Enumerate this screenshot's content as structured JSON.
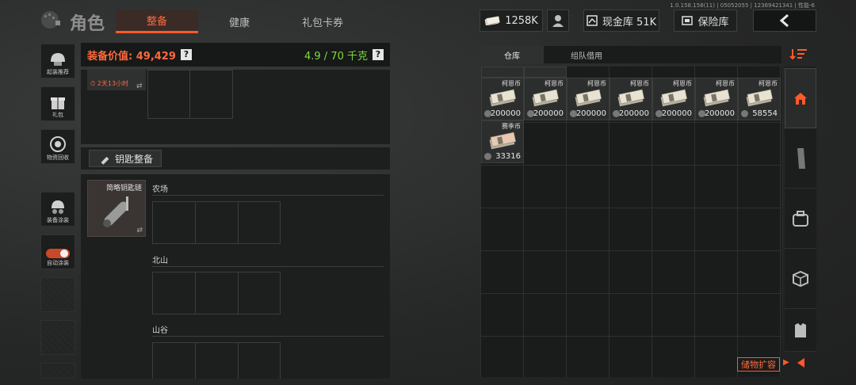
{
  "version_text": "1.0.158.158(11) | 05052055 | 12369421341 | 性能-6",
  "header": {
    "title": "角色",
    "tabs": [
      {
        "label": "整备",
        "active": true
      },
      {
        "label": "健康",
        "active": false
      },
      {
        "label": "礼包卡券",
        "active": false
      }
    ],
    "currency_amount": "1258K",
    "cash_vault_label": "现金库 51K",
    "safe_label": "保险库"
  },
  "sidebar": {
    "items": [
      {
        "label": "起装推荐",
        "icon": "helmet-icon"
      },
      {
        "label": "礼包",
        "icon": "gift-icon"
      },
      {
        "label": "物资回收",
        "icon": "recycle-icon"
      },
      {
        "label": "装备涂装",
        "icon": "paint-icon"
      },
      {
        "label": "自动涂装",
        "icon": "toggle-icon"
      }
    ]
  },
  "loadout": {
    "value_label": "装备价值: 49,429",
    "weight_label": "4.9 / 70 千克",
    "timer_label": "2天13小时",
    "key_button_label": "钥匙整备",
    "keychain_label": "简略钥匙链",
    "sections": [
      "农场",
      "北山",
      "山谷"
    ]
  },
  "inventory": {
    "tabs": [
      {
        "label": "仓库",
        "active": true
      },
      {
        "label": "组队借用",
        "active": false
      }
    ],
    "items": [
      {
        "name": "柯恩币",
        "qty": "200000"
      },
      {
        "name": "柯恩币",
        "qty": "200000"
      },
      {
        "name": "柯恩币",
        "qty": "200000"
      },
      {
        "name": "柯恩币",
        "qty": "200000"
      },
      {
        "name": "柯恩币",
        "qty": "200000"
      },
      {
        "name": "柯恩币",
        "qty": "200000"
      },
      {
        "name": "柯恩币",
        "qty": "58554"
      },
      {
        "name": "赛季币",
        "qty": "33316"
      }
    ],
    "expand_label": "储物扩容"
  },
  "colors": {
    "accent": "#ff5a2a",
    "weight_green": "#7ddc3c",
    "value_orange": "#ff6a3d"
  }
}
